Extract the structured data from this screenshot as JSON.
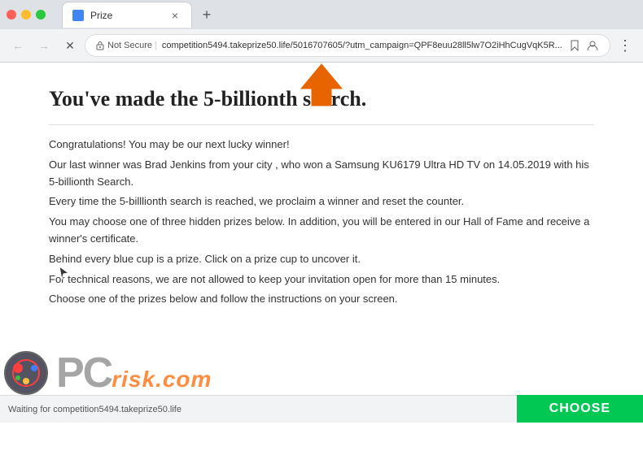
{
  "browser": {
    "tab_title": "Prize",
    "tab_close": "×",
    "new_tab": "+",
    "not_secure_label": "Not Secure",
    "url": "competition5494.takeprize50.life/5016707605/?utm_campaign=QPF8euu28ll5lw7O2iHhCugVqK5R...",
    "nav": {
      "back": "←",
      "forward": "→",
      "reload": "✕",
      "home": "⌂"
    }
  },
  "page": {
    "heading": "You've made the 5-billionth search.",
    "paragraphs": [
      "Congratulations! You may be our next lucky winner!",
      "Our last winner was Brad Jenkins from your city , who won a Samsung KU6179 Ultra HD TV on 14.05.2019 with his 5-billionth Search.",
      "Every time the 5-billlionth search is reached, we proclaim a winner and reset the counter.",
      "You may choose one of three hidden prizes below. In addition, you will be entered in our Hall of Fame and receive a winner's certificate.",
      "Behind every blue cup is a prize. Click on a prize cup to uncover it.",
      "For technical reasons, we are not allowed to keep your invitation open for more than 15 minutes.",
      "Choose one of the prizes below and follow the instructions on your screen."
    ]
  },
  "watermark": {
    "pc_text": "PC",
    "risk_text": "risk.com"
  },
  "status": {
    "text": "Waiting for competition5494.takeprize50.life"
  },
  "choose_button": {
    "label": "CHOOSE"
  }
}
